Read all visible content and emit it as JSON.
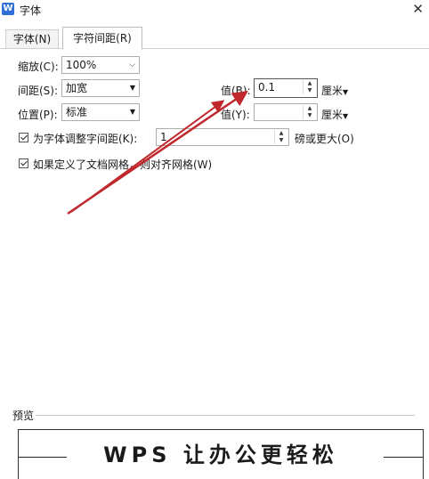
{
  "window": {
    "icon_letter": "W",
    "title": "字体",
    "close_glyph": "✕"
  },
  "tabs": [
    {
      "label": "字体(N)"
    },
    {
      "label": "字符间距(R)"
    }
  ],
  "scale": {
    "label": "缩放(C):",
    "value": "100%"
  },
  "spacing": {
    "label": "间距(S):",
    "value": "加宽",
    "value_label": "值(B):",
    "amount": "0.1",
    "unit": "厘米"
  },
  "position": {
    "label": "位置(P):",
    "value": "标准",
    "value_label": "值(Y):",
    "amount": "",
    "unit": "厘米"
  },
  "kerning": {
    "label": "为字体调整字间距(K):",
    "value": "1",
    "suffix": "磅或更大(O)",
    "checked": true
  },
  "grid": {
    "label": "如果定义了文档网格，则对齐网格(W)",
    "checked": true
  },
  "preview": {
    "label": "预览",
    "sample_text": "WPS 让办公更轻松"
  },
  "annotation": {
    "color": "#c0282d"
  }
}
